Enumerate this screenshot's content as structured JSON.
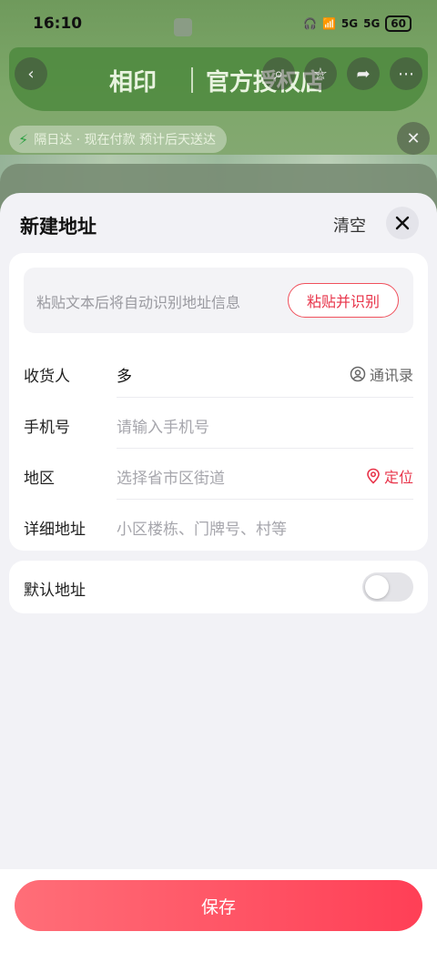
{
  "status_bar": {
    "time": "16:10",
    "battery": "60",
    "network_1": "5G",
    "network_2": "5G"
  },
  "background": {
    "brand_logo": "相印",
    "store_label": "官方授权店",
    "delivery_notice": "隔日达 · 现在付款 预计后天送达"
  },
  "sheet": {
    "title": "新建地址",
    "clear_label": "清空",
    "paste": {
      "hint": "粘贴文本后将自动识别地址信息",
      "button_label": "粘贴并识别"
    },
    "fields": {
      "recipient": {
        "label": "收货人",
        "value": "多",
        "action_label": "通讯录"
      },
      "phone": {
        "label": "手机号",
        "placeholder": "请输入手机号"
      },
      "region": {
        "label": "地区",
        "placeholder": "选择省市区街道",
        "action_label": "定位"
      },
      "address": {
        "label": "详细地址",
        "placeholder": "小区楼栋、门牌号、村等"
      }
    },
    "default_address": {
      "label": "默认地址",
      "enabled": false
    }
  },
  "footer": {
    "save_label": "保存"
  },
  "colors": {
    "accent": "#e8344a",
    "save_gradient_start": "#ff6e78",
    "save_gradient_end": "#ff3f56"
  }
}
